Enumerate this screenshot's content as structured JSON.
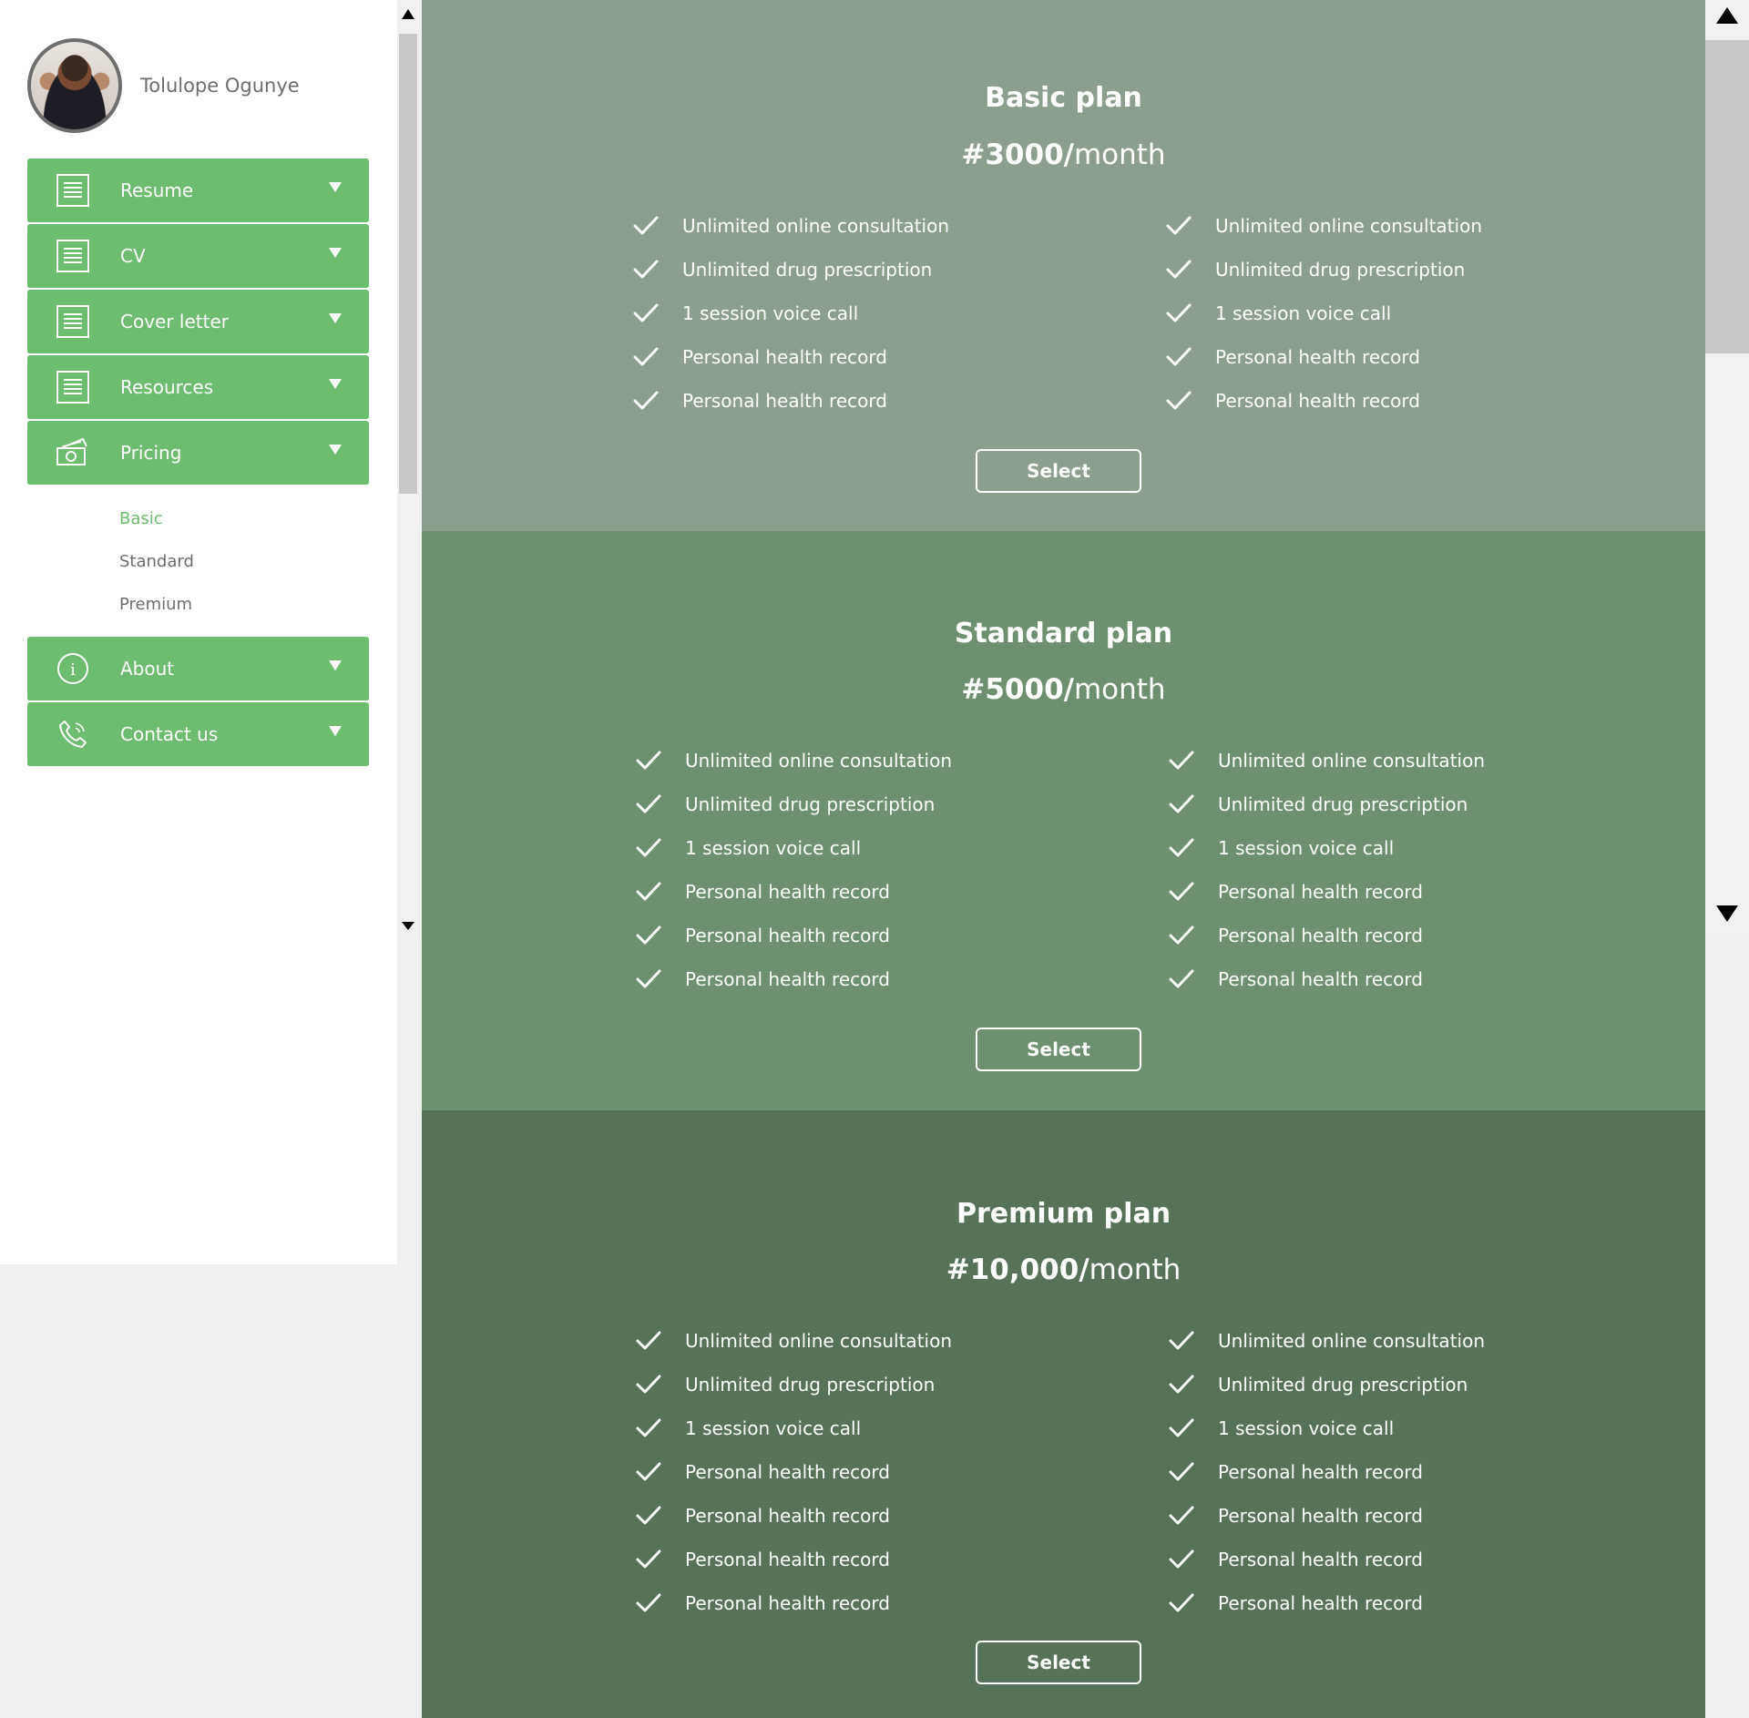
{
  "profile": {
    "name": "Tolulope Ogunye"
  },
  "menu": {
    "items_top": [
      {
        "label": "Resume",
        "icon": "document-icon"
      },
      {
        "label": "CV",
        "icon": "document-icon"
      },
      {
        "label": "Cover letter",
        "icon": "document-icon"
      },
      {
        "label": "Resources",
        "icon": "document-icon"
      },
      {
        "label": "Pricing",
        "icon": "money-icon"
      }
    ],
    "pricing_sub": [
      {
        "label": "Basic",
        "active": true
      },
      {
        "label": "Standard",
        "active": false
      },
      {
        "label": "Premium",
        "active": false
      }
    ],
    "items_bottom": [
      {
        "label": "About",
        "icon": "info-icon"
      },
      {
        "label": "Contact us",
        "icon": "phone-icon"
      }
    ]
  },
  "colors": {
    "accent": "#6cbd6d",
    "basic_bg": "#8c9e8d",
    "standard_bg": "#6e8f70",
    "premium_bg": "#577258"
  },
  "plans": [
    {
      "id": "basic",
      "title": "Basic plan",
      "price_amount": "#3000/",
      "price_period": "month",
      "select_label": "Select",
      "features_left": [
        "Unlimited online consultation",
        "Unlimited drug prescription",
        "1 session voice call",
        "Personal health record",
        "Personal health record"
      ],
      "features_right": [
        "Unlimited online consultation",
        "Unlimited drug prescription",
        "1 session voice call",
        "Personal health record",
        "Personal health record"
      ]
    },
    {
      "id": "standard",
      "title": "Standard plan",
      "price_amount": "#5000/",
      "price_period": "month",
      "select_label": "Select",
      "features_left": [
        "Unlimited online consultation",
        "Unlimited drug prescription",
        "1 session voice call",
        "Personal health record",
        "Personal health record",
        "Personal health record"
      ],
      "features_right": [
        "Unlimited online consultation",
        "Unlimited drug prescription",
        "1 session voice call",
        "Personal health record",
        "Personal health record",
        "Personal health record"
      ]
    },
    {
      "id": "premium",
      "title": "Premium plan",
      "price_amount": "#10,000/",
      "price_period": "month",
      "select_label": "Select",
      "features_left": [
        "Unlimited online consultation",
        "Unlimited drug prescription",
        "1 session voice call",
        "Personal health record",
        "Personal health record",
        "Personal health record",
        "Personal health record"
      ],
      "features_right": [
        "Unlimited online consultation",
        "Unlimited drug prescription",
        "1 session voice call",
        "Personal health record",
        "Personal health record",
        "Personal health record",
        "Personal health record"
      ]
    }
  ]
}
